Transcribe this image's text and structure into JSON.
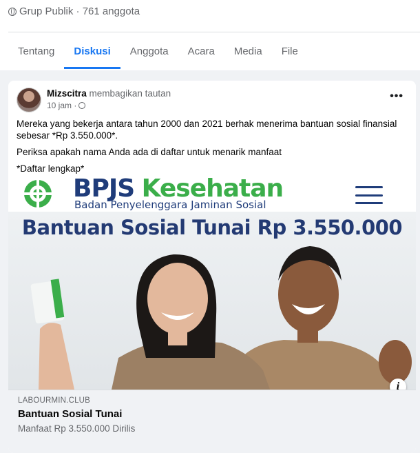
{
  "group": {
    "meta": "Grup Publik · 761 anggota",
    "globe_icon": "globe-icon"
  },
  "tabs": [
    {
      "label": "Tentang",
      "active": false
    },
    {
      "label": "Diskusi",
      "active": true
    },
    {
      "label": "Anggota",
      "active": false
    },
    {
      "label": "Acara",
      "active": false
    },
    {
      "label": "Media",
      "active": false
    },
    {
      "label": "File",
      "active": false
    }
  ],
  "post": {
    "author": "Mizscitra",
    "action": "membagikan tautan",
    "time": "10 jam ·",
    "more_label": "•••",
    "paragraphs": [
      "Mereka yang bekerja antara tahun 2000 dan 2021 berhak menerima bantuan sosial finansial sebesar *Rp 3.550.000*.",
      "Periksa apakah nama Anda ada di daftar untuk menarik manfaat",
      "*Daftar lengkap*"
    ]
  },
  "link_image": {
    "brand_bpjs": "BPJS",
    "brand_kesehatan": "Kesehatan",
    "brand_subtitle": "Badan Penyelenggara Jaminan Sosial",
    "headline": "Bantuan Sosial Tunai Rp 3.550.000",
    "info_label": "i"
  },
  "link": {
    "domain": "LABOURMIN.CLUB",
    "title": "Bantuan Sosial Tunai",
    "description": "Manfaat Rp 3.550.000 Dirilis"
  },
  "colors": {
    "accent": "#1877f2",
    "brand_blue": "#1f3c7a",
    "brand_green": "#3bae4a"
  }
}
